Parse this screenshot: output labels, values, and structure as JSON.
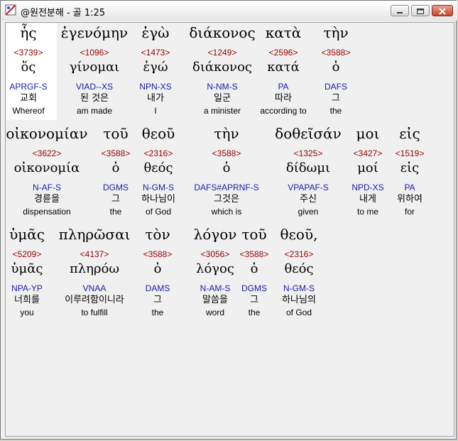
{
  "window": {
    "title": "@원전분해 - 골 1:25",
    "minimize_label": "",
    "maximize_label": "",
    "close_label": ""
  },
  "colors": {
    "strong": "#990000",
    "parse": "#1a1aa8",
    "text": "#000000"
  },
  "rows": [
    {
      "words": [
        {
          "greek": "ἧς",
          "strong": "<3739>",
          "lemma": "ὅς",
          "parse": "APRGF-S",
          "korean": "교회",
          "english": "Whereof"
        },
        {
          "greek": "ἐγενόμην",
          "strong": "<1096>",
          "lemma": "γίνομαι",
          "parse": "VIAD--XS",
          "korean": "된 것은",
          "english": "am made"
        },
        {
          "greek": "ἐγὼ",
          "strong": "<1473>",
          "lemma": "ἐγώ",
          "parse": "NPN-XS",
          "korean": "내가",
          "english": "I"
        },
        {
          "greek": "διάκονος",
          "strong": "<1249>",
          "lemma": "διάκονος",
          "parse": "N-NM-S",
          "korean": "일군",
          "english": "a minister"
        },
        {
          "greek": "κατὰ",
          "strong": "<2596>",
          "lemma": "κατά",
          "parse": "PA",
          "korean": "따라",
          "english": "according to"
        },
        {
          "greek": "τὴν",
          "strong": "<3588>",
          "lemma": "ὁ",
          "parse": "DAFS",
          "korean": "그",
          "english": "the"
        }
      ]
    },
    {
      "words": [
        {
          "greek": "οἰκονομίαν",
          "strong": "<3622>",
          "lemma": "οἰκονομία",
          "parse": "N-AF-S",
          "korean": "경륜을",
          "english": "dispensation"
        },
        {
          "greek": "τοῦ",
          "strong": "<3588>",
          "lemma": "ὁ",
          "parse": "DGMS",
          "korean": "그",
          "english": "the"
        },
        {
          "greek": "θεοῦ",
          "strong": "<2316>",
          "lemma": "θεός",
          "parse": "N-GM-S",
          "korean": "하나님이",
          "english": "of God"
        },
        {
          "greek": "τὴν",
          "strong": "<3588>",
          "lemma": "ὁ",
          "parse": "DAFS#APRNF-S",
          "korean": "그것은",
          "english": "which is"
        },
        {
          "greek": "δοθεῖσάν",
          "strong": "<1325>",
          "lemma": "δίδωμι",
          "parse": "VPAPAF-S",
          "korean": "주신",
          "english": "given"
        },
        {
          "greek": "μοι",
          "strong": "<3427>",
          "lemma": "μοί",
          "parse": "NPD-XS",
          "korean": "내게",
          "english": "to me"
        },
        {
          "greek": "εἰς",
          "strong": "<1519>",
          "lemma": "εἰς",
          "parse": "PA",
          "korean": "위하여",
          "english": "for"
        }
      ]
    },
    {
      "words": [
        {
          "greek": "ὑμᾶς",
          "strong": "<5209>",
          "lemma": "ὑμᾶς",
          "parse": "NPA-YP",
          "korean": "너희를",
          "english": "you"
        },
        {
          "greek": "πληρῶσαι",
          "strong": "<4137>",
          "lemma": "πληρόω",
          "parse": "VNAA",
          "korean": "이루려함이니라",
          "english": "to fulfill"
        },
        {
          "greek": "τὸν",
          "strong": "<3588>",
          "lemma": "ὁ",
          "parse": "DAMS",
          "korean": "그",
          "english": "the"
        },
        {
          "greek": "λόγον",
          "strong": "<3056>",
          "lemma": "λόγος",
          "parse": "N-AM-S",
          "korean": "말씀을",
          "english": "word"
        },
        {
          "greek": "τοῦ",
          "strong": "<3588>",
          "lemma": "ὁ",
          "parse": "DGMS",
          "korean": "그",
          "english": "the"
        },
        {
          "greek": "θεοῦ,",
          "strong": "<2316>",
          "lemma": "θεός",
          "parse": "N-GM-S",
          "korean": "하나님의",
          "english": "of God"
        }
      ]
    }
  ]
}
